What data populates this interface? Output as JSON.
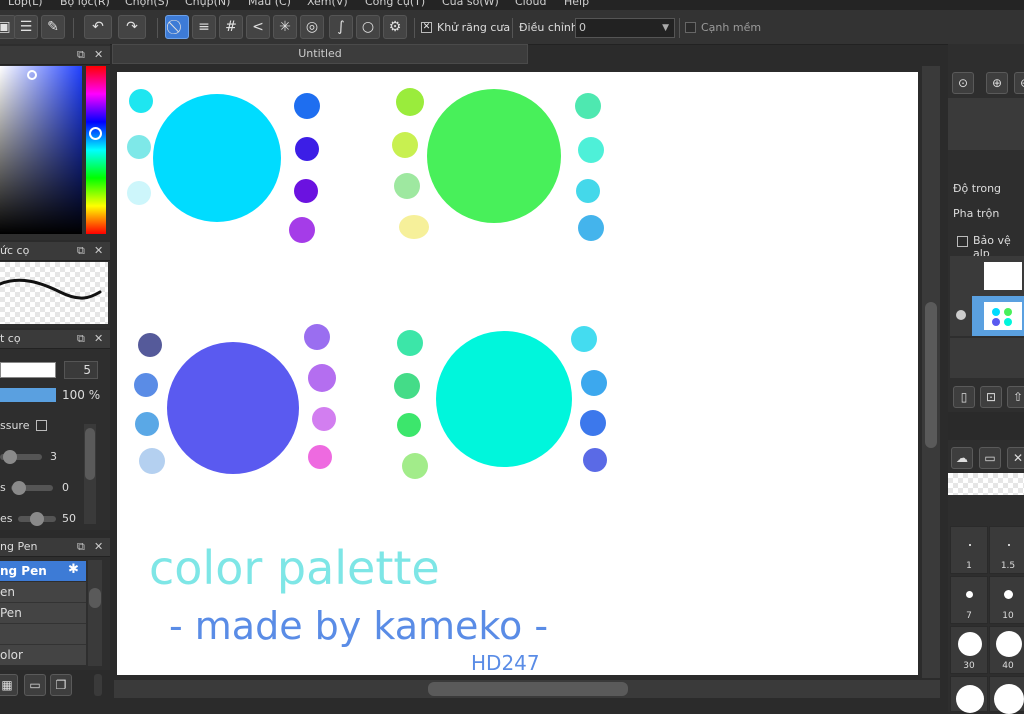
{
  "menu": {
    "items": [
      "Lớp(L)",
      "Bộ lọc(R)",
      "Chọn(S)",
      "Chụp(N)",
      "Màu (C)",
      "Xem(V)",
      "Công cụ(T)",
      "Cửa sổ(W)",
      "Cloud",
      "Help"
    ]
  },
  "toolbar": {
    "antialias_label": "Khử răng cưa",
    "antialias_checked": true,
    "adjust_label": "Điều chỉnh",
    "adjust_value": "0",
    "soft_edge_label": "Cạnh mềm"
  },
  "document": {
    "tab_title": "Untitled"
  },
  "canvas_art": {
    "title_text": "color palette",
    "subtitle_text": "- made by kameko -",
    "signature_text": "HD247",
    "swatches": {
      "group1_big": "#00dcff",
      "group1_left": [
        "#1ee6f0",
        "#7ee8e8",
        "#cdf6fb"
      ],
      "group1_right": [
        "#1e6ef0",
        "#3c1ee6",
        "#6b12e0",
        "#a53ce8"
      ],
      "group2_big": "#48f05a",
      "group2_left": [
        "#9aec3c",
        "#c8f050",
        "#9ee8a0",
        "#f6f09a"
      ],
      "group2_right": [
        "#4ee8b0",
        "#4ef0d8",
        "#44d8ea",
        "#44b4ec"
      ],
      "group3_big": "#5a5af0",
      "group3_left": [
        "#555a9a",
        "#5a8ce6",
        "#5aa8e6",
        "#b4d0f0"
      ],
      "group3_right": [
        "#9a6ef0",
        "#b46ef0",
        "#d27ef0",
        "#ee6ae0"
      ],
      "group4_big": "#00f6dc",
      "group4_left": [
        "#3ce6a8",
        "#44dc88",
        "#3ce66c",
        "#a2ec8a"
      ],
      "group4_right": [
        "#44dcf0",
        "#3ca8ee",
        "#3c78ec",
        "#5a6ae6"
      ]
    }
  },
  "left_panels": {
    "brush_control_title": "ức cọ",
    "brush_settings_title": "t cọ",
    "size_value": "5",
    "opacity_value": "100 %",
    "pressure_label": "ssure",
    "slider1_value": "3",
    "slider2_label": "s",
    "slider2_value": "0",
    "slider3_label": "es",
    "slider3_value": "50",
    "brush_list_title": "ng Pen",
    "brush_list": [
      "ng Pen",
      "en",
      "Pen",
      "",
      "olor"
    ]
  },
  "right_panels": {
    "opacity_label": "Độ trong",
    "blend_label": "Pha trộn",
    "protect_alpha_label": "Bảo vệ alp",
    "brush_sizes": [
      "1",
      "1.5",
      "7",
      "10",
      "30",
      "40"
    ]
  },
  "colors": {
    "accent": "#3d7bd6",
    "panel_bg": "#2e2e2e"
  }
}
